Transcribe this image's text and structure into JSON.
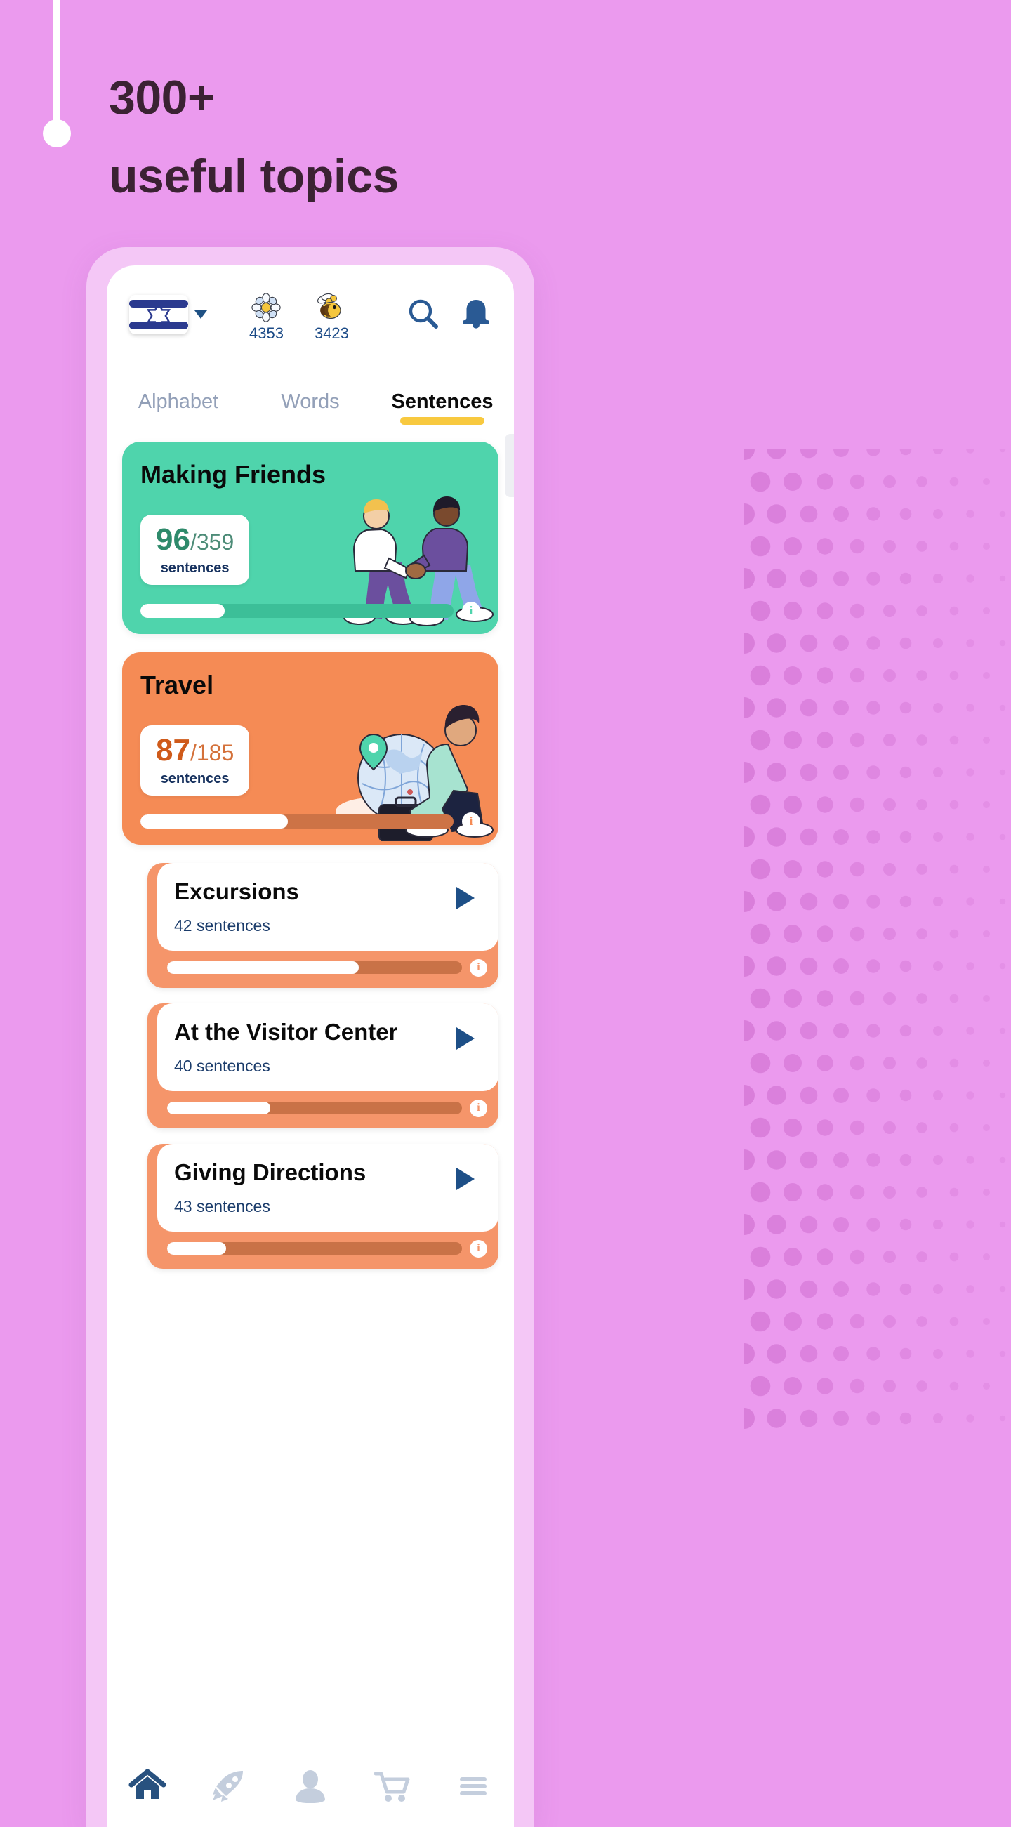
{
  "promo": {
    "headline_line1": "300+",
    "headline_line2": "useful topics",
    "background_color": "#eb9aee",
    "headline_color": "#3b2233"
  },
  "app": {
    "header": {
      "language_flag": "israel-flag",
      "flag_dropdown": "chevron-down",
      "counters": [
        {
          "icon": "daisy-icon",
          "value": "4353"
        },
        {
          "icon": "bee-icon",
          "value": "3423"
        }
      ],
      "search_icon": "search-icon",
      "notifications_icon": "bell-icon"
    },
    "tabs": [
      {
        "label": "Alphabet",
        "active": false
      },
      {
        "label": "Words",
        "active": false
      },
      {
        "label": "Sentences",
        "active": true
      }
    ],
    "active_tab_underline_color": "#f8c93f",
    "topic_cards": [
      {
        "title": "Making Friends",
        "completed": "96",
        "separator": "/",
        "total": "359",
        "unit": "sentences",
        "progress_percent": 27,
        "color": "#4fd4ac",
        "info_icon": "info-icon",
        "illustration": "two-people-shaking-hands"
      },
      {
        "title": "Travel",
        "completed": "87",
        "separator": "/",
        "total": "185",
        "unit": "sentences",
        "progress_percent": 47,
        "color": "#f58b55",
        "info_icon": "info-icon",
        "illustration": "woman-with-globe-and-suitcase"
      }
    ],
    "sub_topics": [
      {
        "name": "Excursions",
        "count": "42 sentences",
        "progress_percent": 65,
        "play_icon": "play-icon",
        "info_icon": "info-icon"
      },
      {
        "name": "At the Visitor Center",
        "count": "40 sentences",
        "progress_percent": 35,
        "play_icon": "play-icon",
        "info_icon": "info-icon"
      },
      {
        "name": "Giving Directions",
        "count": "43 sentences",
        "progress_percent": 20,
        "play_icon": "play-icon",
        "info_icon": "info-icon"
      }
    ],
    "bottom_nav": [
      {
        "icon": "home-icon",
        "active": true
      },
      {
        "icon": "rocket-icon",
        "active": false
      },
      {
        "icon": "profile-icon",
        "active": false
      },
      {
        "icon": "cart-icon",
        "active": false
      },
      {
        "icon": "menu-icon",
        "active": false
      }
    ]
  }
}
